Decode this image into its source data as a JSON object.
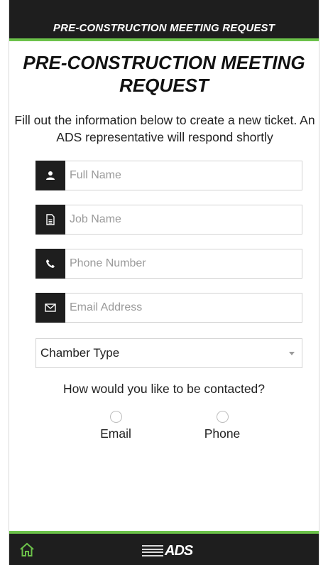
{
  "header": {
    "title": "PRE-CONSTRUCTION MEETING REQUEST"
  },
  "page": {
    "title_line1": "PRE-CONSTRUCTION MEETING",
    "title_line2": "REQUEST",
    "intro": "Fill out the information below to create a new ticket. An ADS representative will respond shortly"
  },
  "form": {
    "full_name": {
      "placeholder": "Full Name",
      "icon": "user-icon"
    },
    "job_name": {
      "placeholder": "Job Name",
      "icon": "document-icon"
    },
    "phone_number": {
      "placeholder": "Phone Number",
      "icon": "phone-icon"
    },
    "email_address": {
      "placeholder": "Email Address",
      "icon": "envelope-icon"
    },
    "chamber_type": {
      "selected": "Chamber Type"
    },
    "contact_question": "How would you like to be contacted?",
    "contact_options": [
      "Email",
      "Phone"
    ]
  },
  "footer": {
    "home_icon": "home-icon",
    "logo_text": "ADS"
  },
  "colors": {
    "bar": "#1e1e1e",
    "accent": "#6cc24a"
  }
}
